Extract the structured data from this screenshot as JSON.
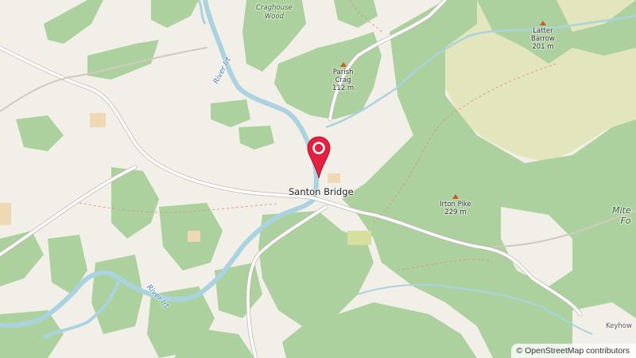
{
  "map": {
    "labels": {
      "craghouse_wood": "Craghouse\nWood",
      "parish_crag": "Parish\nCrag\n112 m",
      "latter_barrow": "Latter\nBarrow\n201 m",
      "irton_pike": "Irton Pike\n229 m",
      "santon_bridge": "Santon Bridge",
      "river_irt_1": "River Irt",
      "river_irt_2": "River Irt",
      "miterdale": "Mite\nFo",
      "keyhow": "Keyhow"
    },
    "marker": {
      "icon": "map-pin-icon",
      "color": "#e3203f"
    },
    "attribution": "© OpenStreetMap contributors",
    "colors": {
      "background": "#f2efe9",
      "woodland": "#add19e",
      "river": "#aad3df",
      "road": "#ffffff",
      "heath": "#e0e5b8"
    }
  }
}
